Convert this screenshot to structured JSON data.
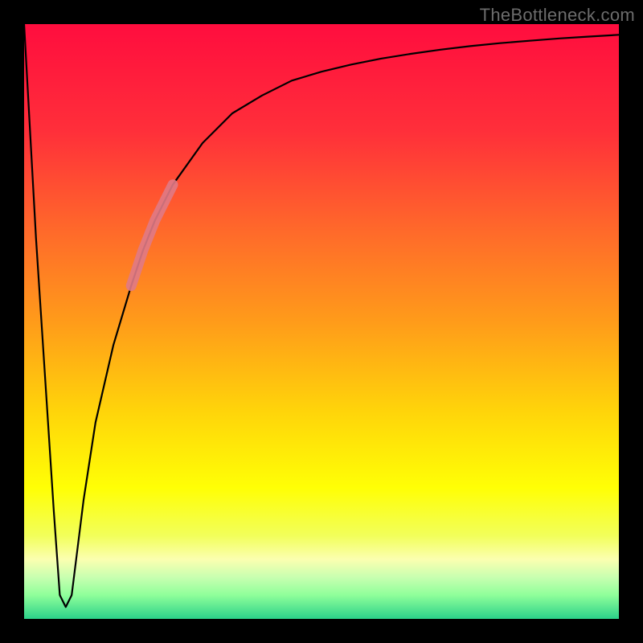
{
  "watermark": "TheBottleneck.com",
  "gradient_stops": [
    {
      "pos": 0.0,
      "color": "#ff0d3e"
    },
    {
      "pos": 0.18,
      "color": "#ff2f3a"
    },
    {
      "pos": 0.35,
      "color": "#ff6a2a"
    },
    {
      "pos": 0.5,
      "color": "#ff9b1a"
    },
    {
      "pos": 0.65,
      "color": "#ffd40a"
    },
    {
      "pos": 0.78,
      "color": "#ffff05"
    },
    {
      "pos": 0.86,
      "color": "#f2ff5a"
    },
    {
      "pos": 0.9,
      "color": "#fbffb0"
    },
    {
      "pos": 0.93,
      "color": "#c8ffb0"
    },
    {
      "pos": 0.96,
      "color": "#8fff9a"
    },
    {
      "pos": 1.0,
      "color": "#2bd18a"
    }
  ],
  "chart_data": {
    "type": "line",
    "title": "",
    "xlabel": "",
    "ylabel": "",
    "xlim": [
      0,
      100
    ],
    "ylim": [
      0,
      100
    ],
    "series": [
      {
        "name": "bottleneck-curve",
        "x": [
          0,
          2,
          5,
          6,
          7,
          8,
          10,
          12,
          15,
          18,
          20,
          22,
          25,
          30,
          35,
          40,
          45,
          50,
          55,
          60,
          65,
          70,
          75,
          80,
          85,
          90,
          95,
          100
        ],
        "values": [
          100,
          64,
          18,
          4,
          2,
          4,
          20,
          33,
          46,
          56,
          62,
          67,
          73,
          80,
          85,
          88,
          90.5,
          92,
          93.2,
          94.2,
          95,
          95.7,
          96.3,
          96.8,
          97.2,
          97.6,
          97.9,
          98.2
        ]
      }
    ],
    "highlight": {
      "name": "highlight-segment",
      "color": "#e07a86",
      "x": [
        18,
        19,
        20,
        21,
        22,
        23,
        24,
        25
      ],
      "values": [
        56,
        59,
        62,
        64.5,
        67,
        69,
        71,
        73
      ]
    }
  }
}
